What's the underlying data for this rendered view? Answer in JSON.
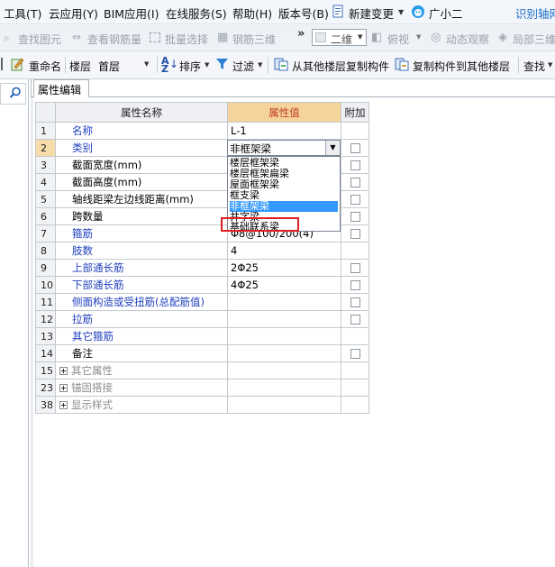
{
  "menubar": {
    "items": [
      "工具(T)",
      "云应用(Y)",
      "BIM应用(I)",
      "在线服务(S)",
      "帮助(H)",
      "版本号(B)",
      "新建变更",
      "广小二",
      "识别轴网"
    ]
  },
  "toolbar1": {
    "find_element": "查找图元",
    "view_rebar": "查看钢筋量",
    "batch_select": "批量选择",
    "rebar_3d": "钢筋三维",
    "more": "»",
    "view_mode": "二维",
    "top_view": "俯视",
    "dynamic_observe": "动态观察",
    "local_3d": "局部三维"
  },
  "toolbar2": {
    "rename": "重命名",
    "floor_label": "楼层",
    "floor_value": "首层",
    "sort": "排序",
    "filter": "过滤",
    "copy_from_floor": "从其他楼层复制构件",
    "copy_to_floor": "复制构件到其他楼层",
    "find": "查找"
  },
  "panel": {
    "tab_label": "属性编辑"
  },
  "grid": {
    "headers": [
      "属性名称",
      "属性值",
      "附加"
    ],
    "rows": [
      {
        "num": "1",
        "name": "名称",
        "value": "L-1",
        "checkbox": false
      },
      {
        "num": "2",
        "name": "类别",
        "value": "非框架梁",
        "checkbox": true
      },
      {
        "num": "3",
        "name": "截面宽度(mm)",
        "value": "",
        "checkbox": true
      },
      {
        "num": "4",
        "name": "截面高度(mm)",
        "value": "",
        "checkbox": true
      },
      {
        "num": "5",
        "name": "轴线距梁左边线距离(mm)",
        "value": "",
        "checkbox": true
      },
      {
        "num": "6",
        "name": "跨数量",
        "value": "",
        "checkbox": true
      },
      {
        "num": "7",
        "name": "箍筋",
        "value": "Φ8@100/200(4)",
        "checkbox": true
      },
      {
        "num": "8",
        "name": "肢数",
        "value": "4",
        "checkbox": false
      },
      {
        "num": "9",
        "name": "上部通长筋",
        "value": "2Φ25",
        "checkbox": true
      },
      {
        "num": "10",
        "name": "下部通长筋",
        "value": "4Φ25",
        "checkbox": true
      },
      {
        "num": "11",
        "name": "侧面构造或受扭筋(总配筋值)",
        "value": "",
        "checkbox": true
      },
      {
        "num": "12",
        "name": "拉筋",
        "value": "",
        "checkbox": true
      },
      {
        "num": "13",
        "name": "其它箍筋",
        "value": "",
        "checkbox": false
      },
      {
        "num": "14",
        "name": "备注",
        "value": "",
        "checkbox": true
      },
      {
        "num": "15",
        "name": "其它属性",
        "value": "",
        "checkbox": false
      },
      {
        "num": "23",
        "name": "锚固搭接",
        "value": "",
        "checkbox": false
      },
      {
        "num": "38",
        "name": "显示样式",
        "value": "",
        "checkbox": false
      }
    ]
  },
  "combo": {
    "value": "非框架梁",
    "options": [
      "楼层框架梁",
      "楼层框架扁梁",
      "屋面框架梁",
      "框支梁",
      "非框架梁",
      "井字梁",
      "基础联系梁"
    ],
    "selected_index": 4
  },
  "colors": {
    "header_highlight": "#f5d49b",
    "selected_option": "#3399ff",
    "blue_label": "#1f3fbf",
    "red_box": "#e02020"
  }
}
